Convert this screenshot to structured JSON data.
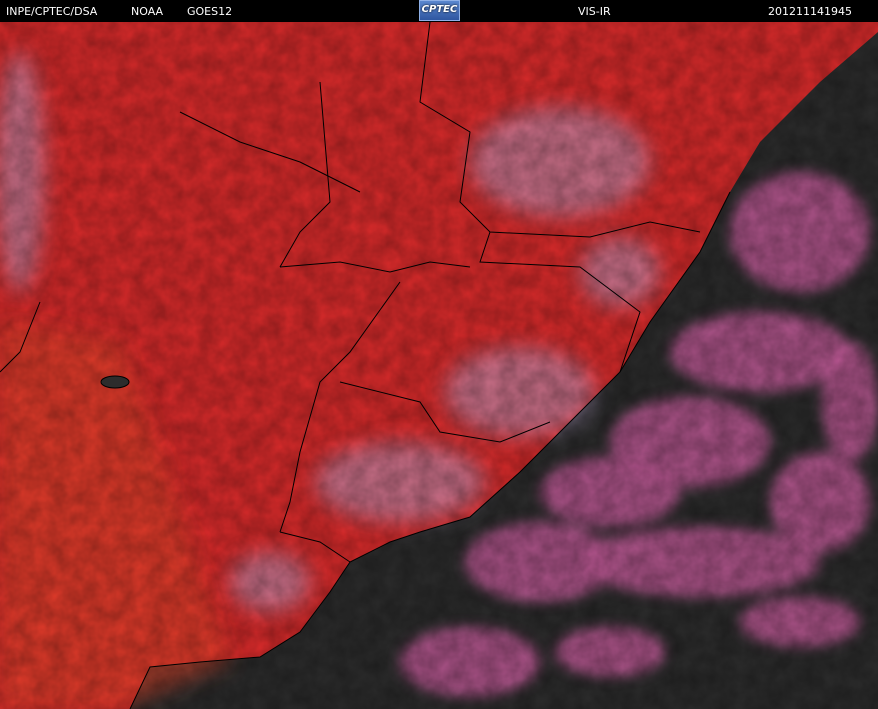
{
  "header": {
    "agency": "INPE/CPTEC/DSA",
    "noaa": "NOAA",
    "satellite": "GOES12",
    "logo_text": "CPTEC",
    "channel": "VIS-IR",
    "timestamp": "201211141945"
  },
  "imagery": {
    "land_color": "#d82b2b",
    "ocean_color": "#2c2c2c",
    "cloud_color": "#c05a96",
    "bright_cloud_color": "#b9a6d2",
    "border_color": "#000000"
  }
}
